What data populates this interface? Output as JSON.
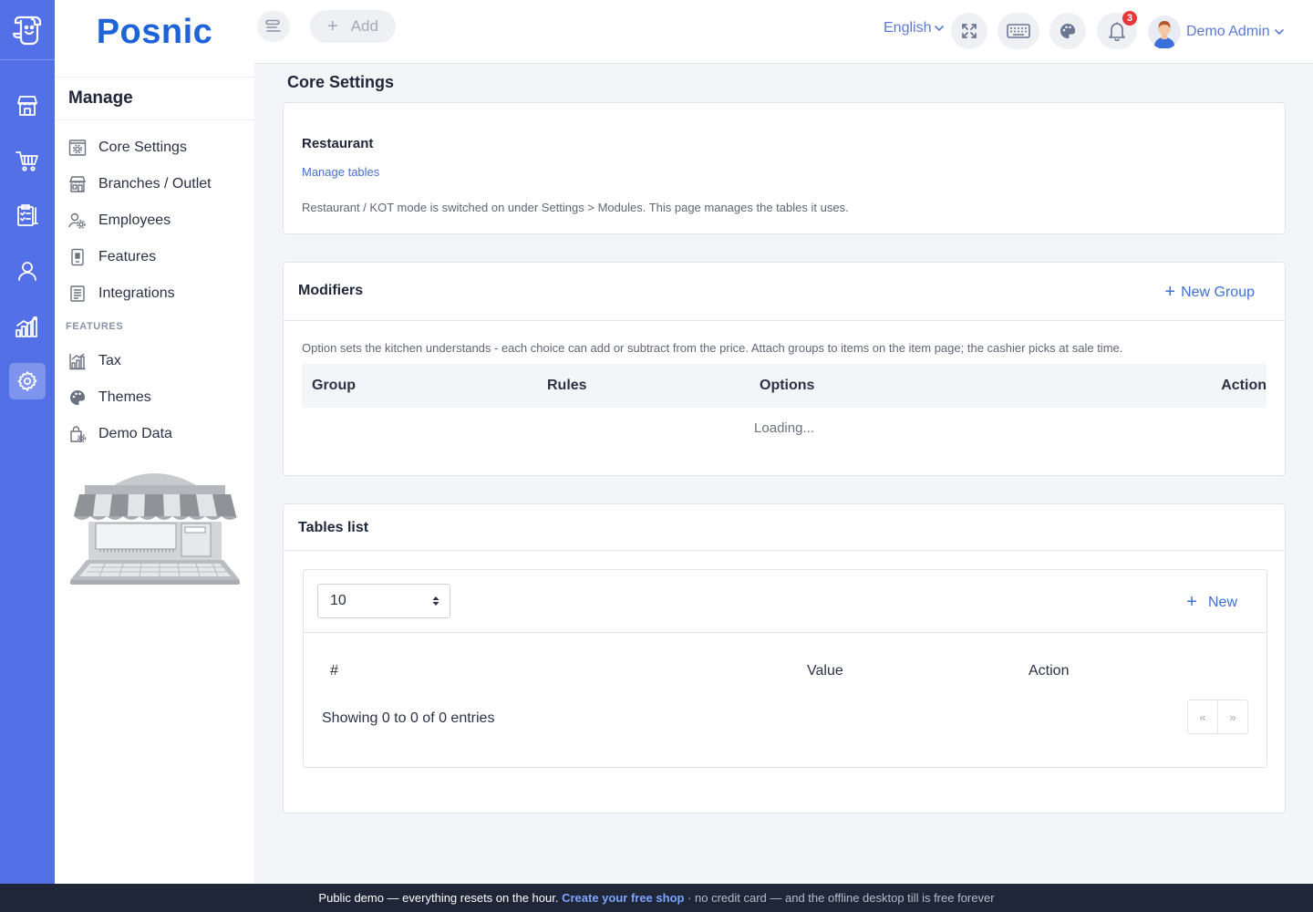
{
  "app": {
    "brand": "Posnic"
  },
  "rail": {
    "items": [
      {
        "icon": "store-icon"
      },
      {
        "icon": "cart-icon"
      },
      {
        "icon": "clipboard-icon"
      },
      {
        "icon": "user-icon"
      },
      {
        "icon": "analytics-icon"
      },
      {
        "icon": "settings-icon",
        "active": true
      }
    ]
  },
  "sidebar": {
    "heading": "Manage",
    "items": [
      {
        "label": "Core Settings",
        "icon": "core-settings-icon"
      },
      {
        "label": "Branches / Outlet",
        "icon": "branch-icon"
      },
      {
        "label": "Employees",
        "icon": "employees-icon"
      },
      {
        "label": "Features",
        "icon": "features-icon"
      },
      {
        "label": "Integrations",
        "icon": "integrations-icon"
      }
    ],
    "section_label": "FEATURES",
    "feature_items": [
      {
        "label": "Tax",
        "icon": "tax-icon"
      },
      {
        "label": "Themes",
        "icon": "palette-icon"
      },
      {
        "label": "Demo Data",
        "icon": "demo-data-icon"
      }
    ]
  },
  "topbar": {
    "add_label": "Add",
    "language": "English",
    "notification_count": "3",
    "user_name": "Demo Admin"
  },
  "main": {
    "page_title": "Core Settings",
    "restaurant": {
      "title": "Restaurant",
      "link": "Manage tables",
      "description": "Restaurant / KOT mode is switched on under Settings > Modules. This page manages the tables it uses."
    },
    "modifiers": {
      "title": "Modifiers",
      "new_group_label": "New Group",
      "description": "Option sets the kitchen understands - each choice can add or subtract from the price. Attach groups to items on the item page; the cashier picks at sale time.",
      "columns": [
        "Group",
        "Rules",
        "Options",
        "Action"
      ],
      "loading_text": "Loading..."
    },
    "tables": {
      "title": "Tables list",
      "page_size": "10",
      "new_label": "New",
      "columns": [
        "#",
        "Value",
        "Action"
      ],
      "showing_text": "Showing 0 to 0 of 0 entries",
      "pager": {
        "prev": "«",
        "next": "»"
      }
    }
  },
  "banner": {
    "text": "Public demo — everything resets on the hour. ",
    "cta": "Create your free shop",
    "rest": " · no credit card — and the offline desktop till is free forever"
  },
  "colors": {
    "rail": "#5470e6",
    "brand": "#1e63d8",
    "accent": "#3f6fd8",
    "badge": "#e5383b",
    "banner": "#1f2638"
  }
}
